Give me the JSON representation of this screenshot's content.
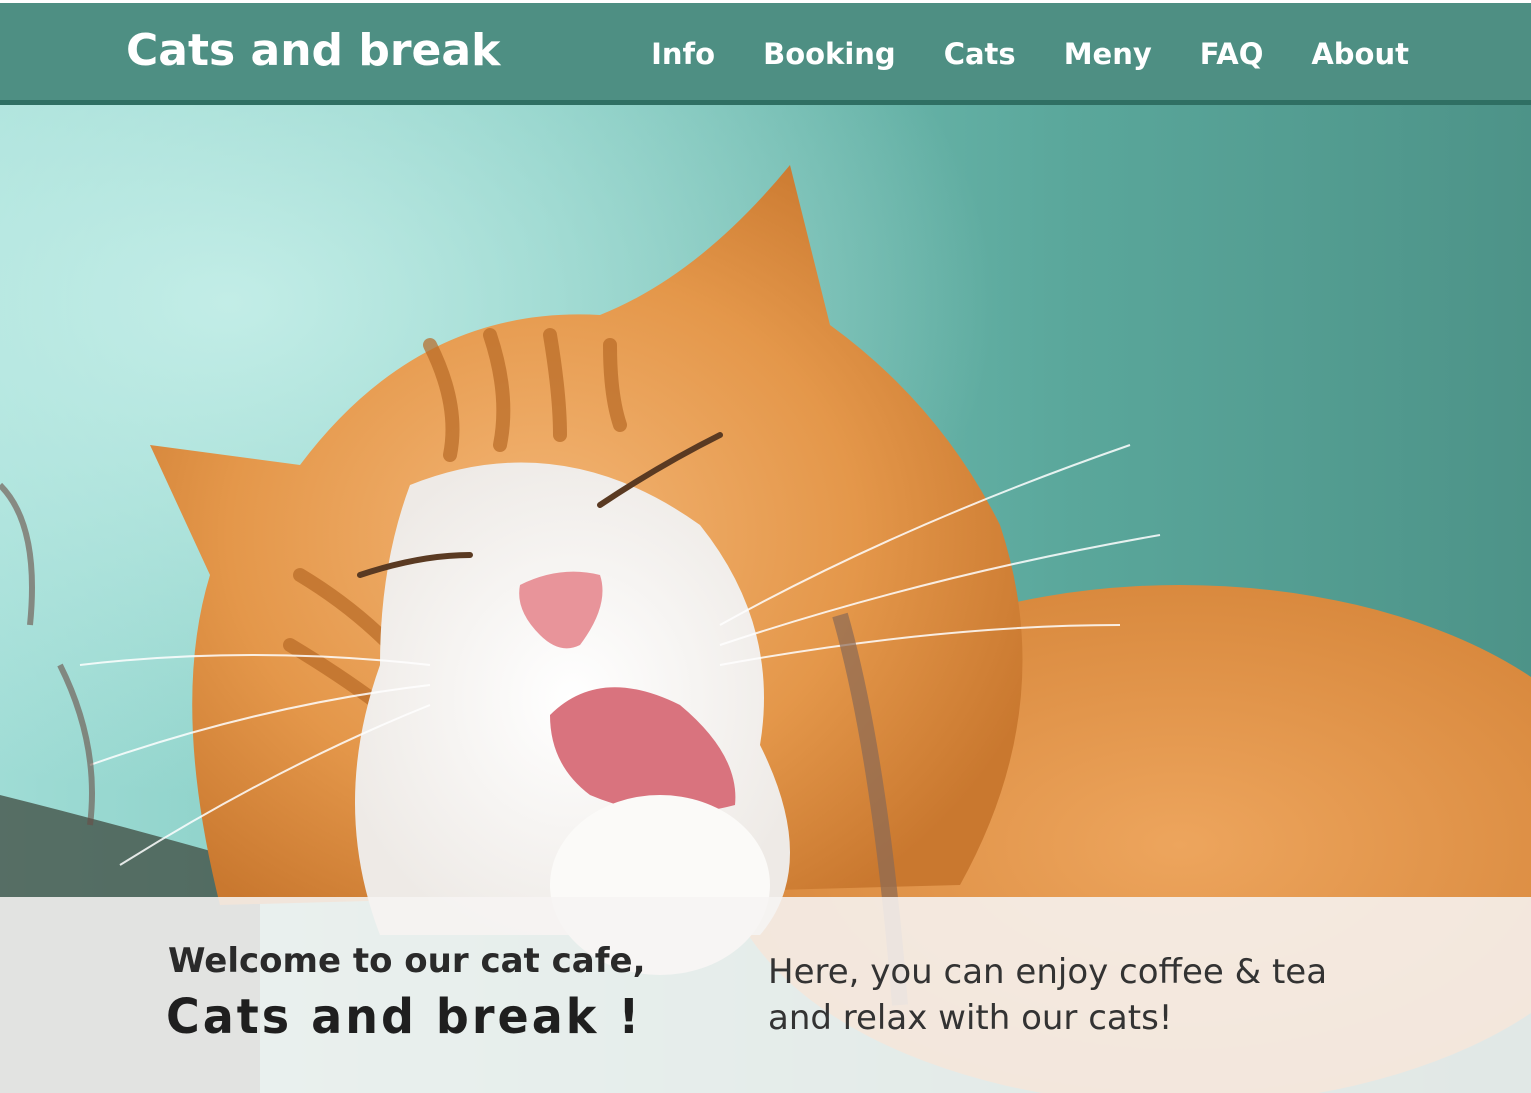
{
  "header": {
    "brand": "Cats and break",
    "nav": [
      {
        "label": "Info"
      },
      {
        "label": "Booking"
      },
      {
        "label": "Cats"
      },
      {
        "label": "Meny"
      },
      {
        "label": "FAQ"
      },
      {
        "label": "About"
      }
    ]
  },
  "hero": {
    "image": "orange-cat-licking-paw-photo"
  },
  "banner": {
    "welcome": "Welcome to our cat cafe,",
    "brand": "Cats and break !",
    "tagline": "Here, you can enjoy coffee & tea and relax with our cats!"
  },
  "colors": {
    "header_bg": "#4e8f83",
    "header_border": "#2f6f63",
    "nav_text": "#ffffff",
    "banner_bg": "#f6f4f2"
  }
}
